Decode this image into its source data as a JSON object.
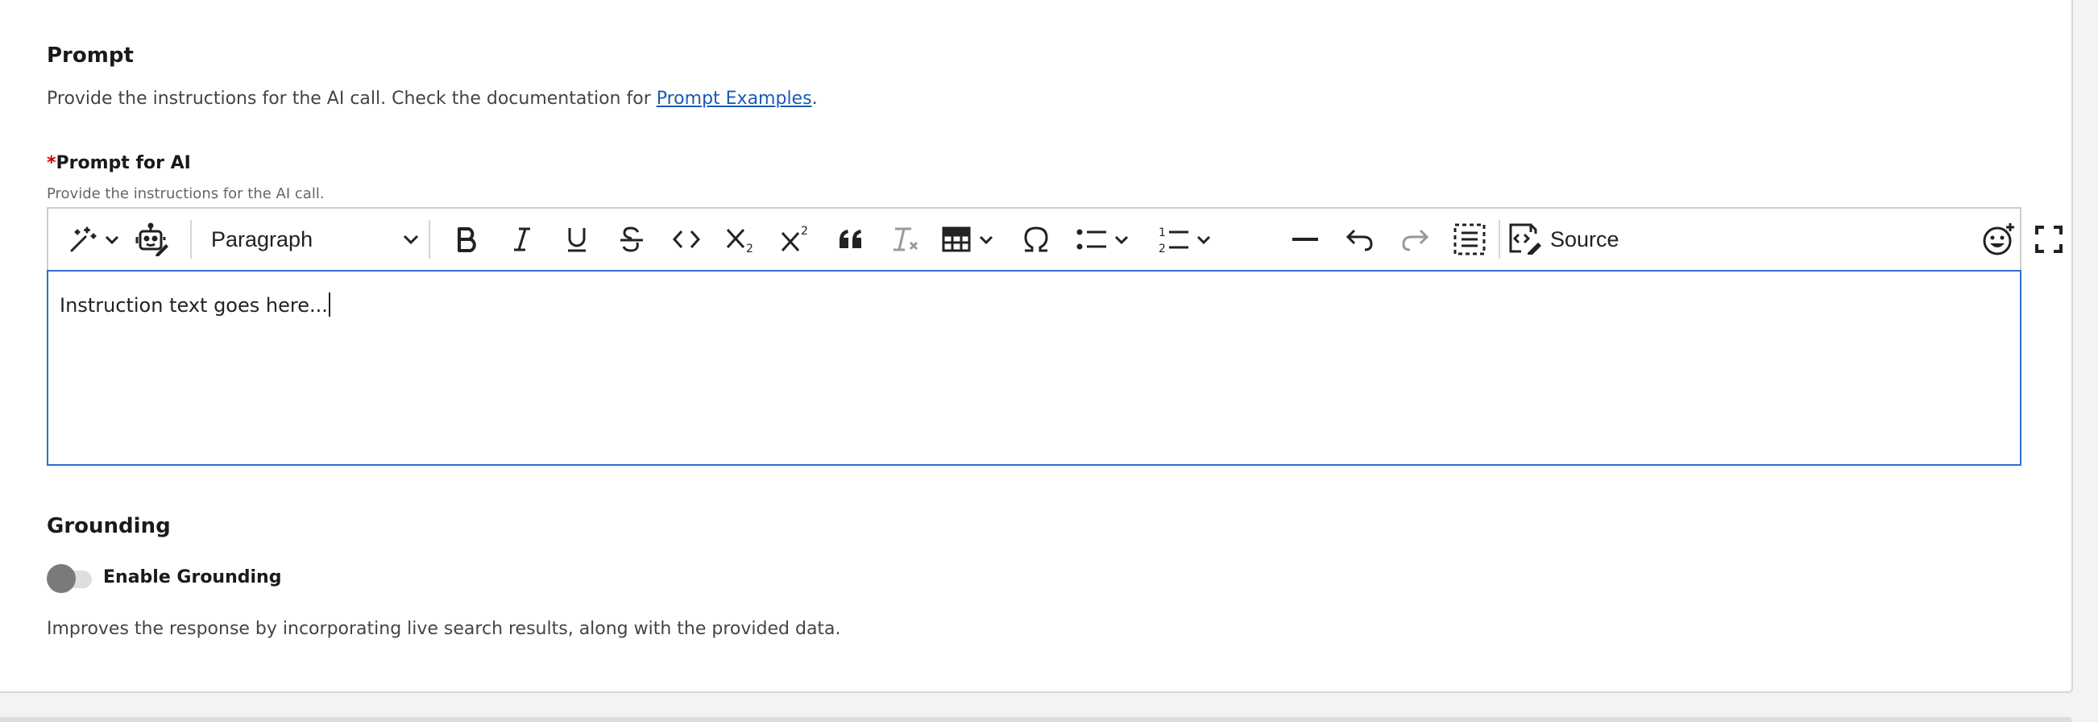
{
  "prompt_section": {
    "title": "Prompt",
    "description_prefix": "Provide the instructions for the AI call. Check the documentation for ",
    "link_text": "Prompt Examples",
    "description_suffix": "."
  },
  "prompt_field": {
    "required_marker": "*",
    "label": "Prompt for AI",
    "help_text": "Provide the instructions for the AI call.",
    "value": "Instruction text goes here..."
  },
  "toolbar": {
    "items": [
      "ai-magic-wand-icon",
      "ai-assistant-robot-icon",
      "paragraph-format",
      "bold-icon",
      "italic-icon",
      "underline-icon",
      "strikethrough-icon",
      "code-icon",
      "subscript-icon",
      "superscript-icon",
      "blockquote-icon",
      "remove-format-icon",
      "table-icon",
      "special-characters-icon",
      "bulleted-list-icon",
      "numbered-list-icon",
      "horizontal-line-icon",
      "undo-icon",
      "redo-icon",
      "show-blocks-icon",
      "source-icon",
      "emoji-icon",
      "fullscreen-icon"
    ],
    "paragraph_value": "Paragraph",
    "source_label": "Source"
  },
  "grounding_section": {
    "title": "Grounding",
    "toggle_label": "Enable Grounding",
    "toggle_enabled": false,
    "description": "Improves the response by incorporating live search results, along with the provided data."
  },
  "colors": {
    "link": "#1a5bb5",
    "required": "#d00000",
    "focus_border": "#2f6fd0"
  }
}
